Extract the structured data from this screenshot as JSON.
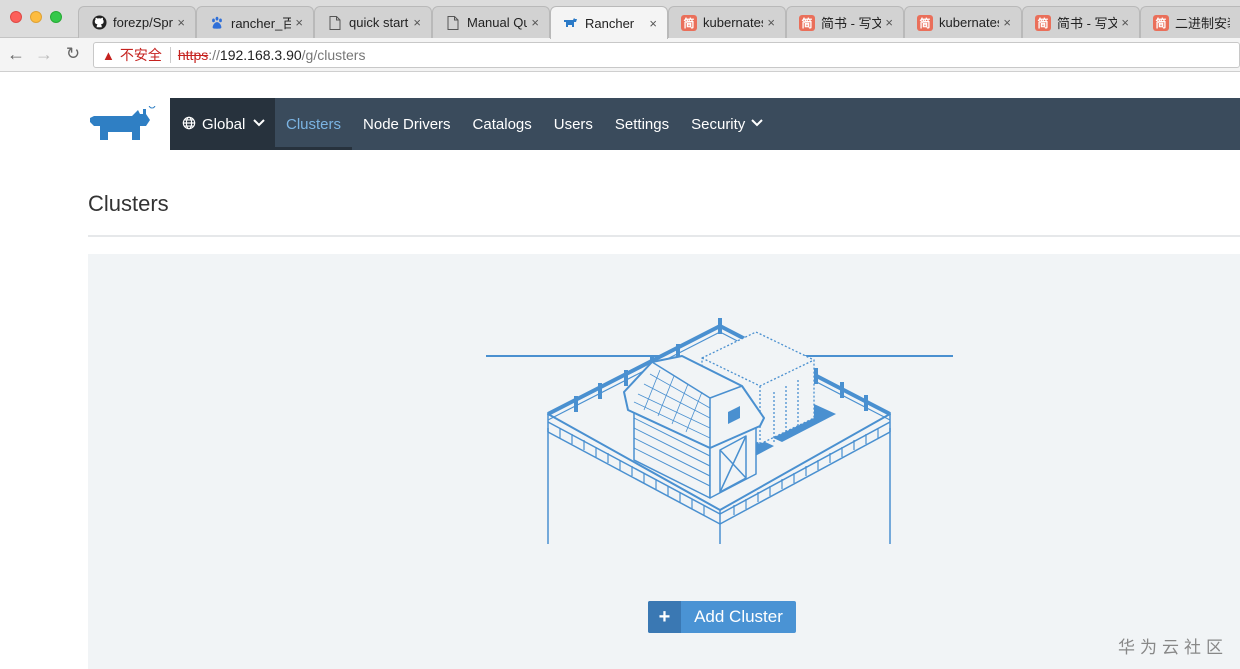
{
  "browser": {
    "tabs": [
      {
        "label": "forezp/Spr",
        "icon": "github-icon"
      },
      {
        "label": "rancher_百",
        "icon": "baidu-paw-icon"
      },
      {
        "label": "quick start",
        "icon": "document-icon"
      },
      {
        "label": "Manual Qu",
        "icon": "document-icon"
      },
      {
        "label": "Rancher",
        "icon": "rancher-icon",
        "active": true
      },
      {
        "label": "kubernates",
        "icon": "jianshu-icon"
      },
      {
        "label": "简书 - 写文",
        "icon": "jianshu-icon"
      },
      {
        "label": "kubernates",
        "icon": "jianshu-icon"
      },
      {
        "label": "简书 - 写文",
        "icon": "jianshu-icon"
      },
      {
        "label": "二进制安装",
        "icon": "jianshu-icon"
      }
    ],
    "tab_close_glyph": "×",
    "jianshu_glyph": "简",
    "address": {
      "insecure_label": "不安全",
      "scheme": "https",
      "scheme_sep": "://",
      "host": "192.168.3.90",
      "path": "/g/clusters"
    }
  },
  "nav": {
    "global_label": "Global",
    "items": [
      {
        "label": "Clusters",
        "active": true
      },
      {
        "label": "Node Drivers"
      },
      {
        "label": "Catalogs"
      },
      {
        "label": "Users"
      },
      {
        "label": "Settings"
      },
      {
        "label": "Security",
        "dropdown": true
      }
    ]
  },
  "page": {
    "title": "Clusters",
    "add_button_label": "Add Cluster",
    "add_button_icon": "+"
  },
  "watermark": "华为云社区",
  "colors": {
    "nav_bg": "#3a4b5c",
    "nav_global_bg": "#27323d",
    "nav_active_text": "#7bb4e3",
    "accent_blue": "#4a93d4",
    "illustration_blue": "#4a90d0",
    "panel_bg": "#f1f4f6",
    "insecure_red": "#c5221f"
  }
}
